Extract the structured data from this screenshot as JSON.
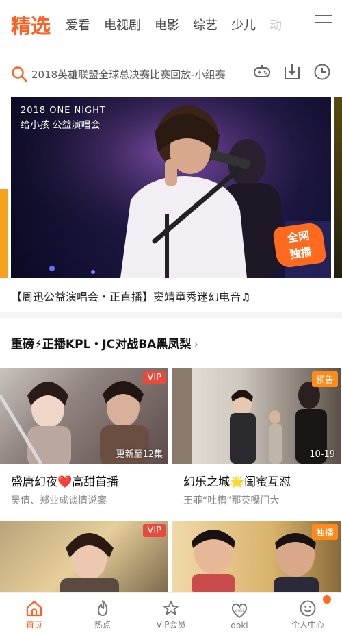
{
  "top_tabs": {
    "active": "精选",
    "items": [
      "爱看",
      "电视剧",
      "电影",
      "综艺",
      "少儿",
      "动"
    ]
  },
  "search": {
    "text": "2018英雄联盟全球总决赛比赛回放-小组赛"
  },
  "banner": {
    "caption_line1": "2018 ONE NIGHT",
    "caption_line2": "给小孩 公益演唱会",
    "badge": "全网\n独播",
    "title": "【周迅公益演唱会・正直播】窦靖童秀迷幻电音♫"
  },
  "section": {
    "title": "重磅⚡正播KPL・JC对战BA黑凤梨",
    "chevron": "›"
  },
  "cards": [
    {
      "tag": "VIP",
      "corner": "更新至12集",
      "title": "盛唐幻夜❤️高甜首播",
      "subtitle": "吴倩、郑业成谈情说案"
    },
    {
      "tag": "预告",
      "corner": "10-19",
      "title": "幻乐之城🌟闺蜜互怼",
      "subtitle": "王菲“吐槽”那英嗓门大"
    },
    {
      "tag": "VIP",
      "corner": "",
      "title": "",
      "subtitle": ""
    },
    {
      "tag": "独播",
      "corner": "",
      "title": "",
      "subtitle": ""
    }
  ],
  "bottom_nav": [
    {
      "label": "首页",
      "icon": "home-icon",
      "active": true
    },
    {
      "label": "热点",
      "icon": "flame-icon",
      "active": false
    },
    {
      "label": "VIP会员",
      "icon": "vip-crown-icon",
      "active": false
    },
    {
      "label": "doki",
      "icon": "doki-heart-icon",
      "active": false
    },
    {
      "label": "个人中心",
      "icon": "smiley-icon",
      "active": false
    }
  ],
  "colors": {
    "accent": "#ff6022",
    "vip_tag": "#e64b3b",
    "orange_tag": "#ff8a1a"
  }
}
